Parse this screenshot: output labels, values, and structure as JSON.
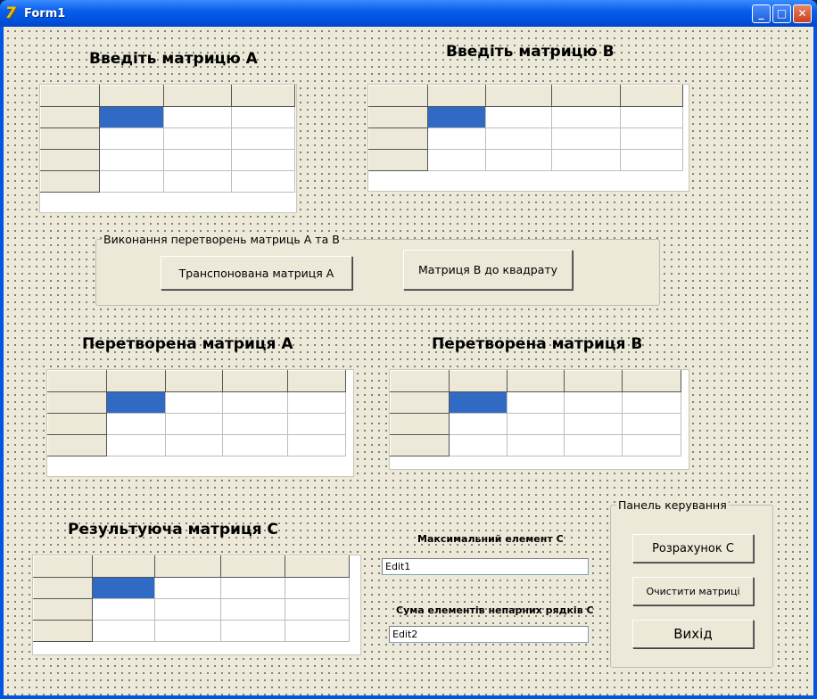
{
  "window": {
    "title": "Form1",
    "icon": "delphi-app-icon"
  },
  "titlebar_buttons": {
    "minimize": "_",
    "maximize": "□",
    "close": "✕"
  },
  "labels": {
    "matrix_a_input": "Введіть матрицю А",
    "matrix_b_input": "Введіть матрицю В",
    "transformed_a": "Перетворена матриця А",
    "transformed_b": "Перетворена матриця В",
    "result_c": "Результуюча матриця С",
    "max_element": "Максимальний елемент С",
    "sum_odd_rows": "Сума елементів непарних рядків С"
  },
  "transform_group": {
    "caption": "Виконання перетворень матриць А та В",
    "transpose_button": "Транспонована матриця А",
    "square_button": "Матриця В до квадрату"
  },
  "control_panel": {
    "caption": "Панель керування",
    "calculate_button": "Розрахунок С",
    "clear_button": "Очистити матриці",
    "exit_button": "Вихід"
  },
  "edits": {
    "edit1": "Edit1",
    "edit2": "Edit2"
  },
  "grids": {
    "matrix_a": {
      "rows": 5,
      "cols": 4
    },
    "matrix_b": {
      "rows": 4,
      "cols": 5
    },
    "transformed_a": {
      "rows": 4,
      "cols": 5
    },
    "transformed_b": {
      "rows": 4,
      "cols": 5
    },
    "result_c": {
      "rows": 4,
      "cols": 5
    }
  },
  "colors": {
    "selection": "#316ac5",
    "face": "#ece9d8",
    "titlebar": "#0054e3"
  }
}
